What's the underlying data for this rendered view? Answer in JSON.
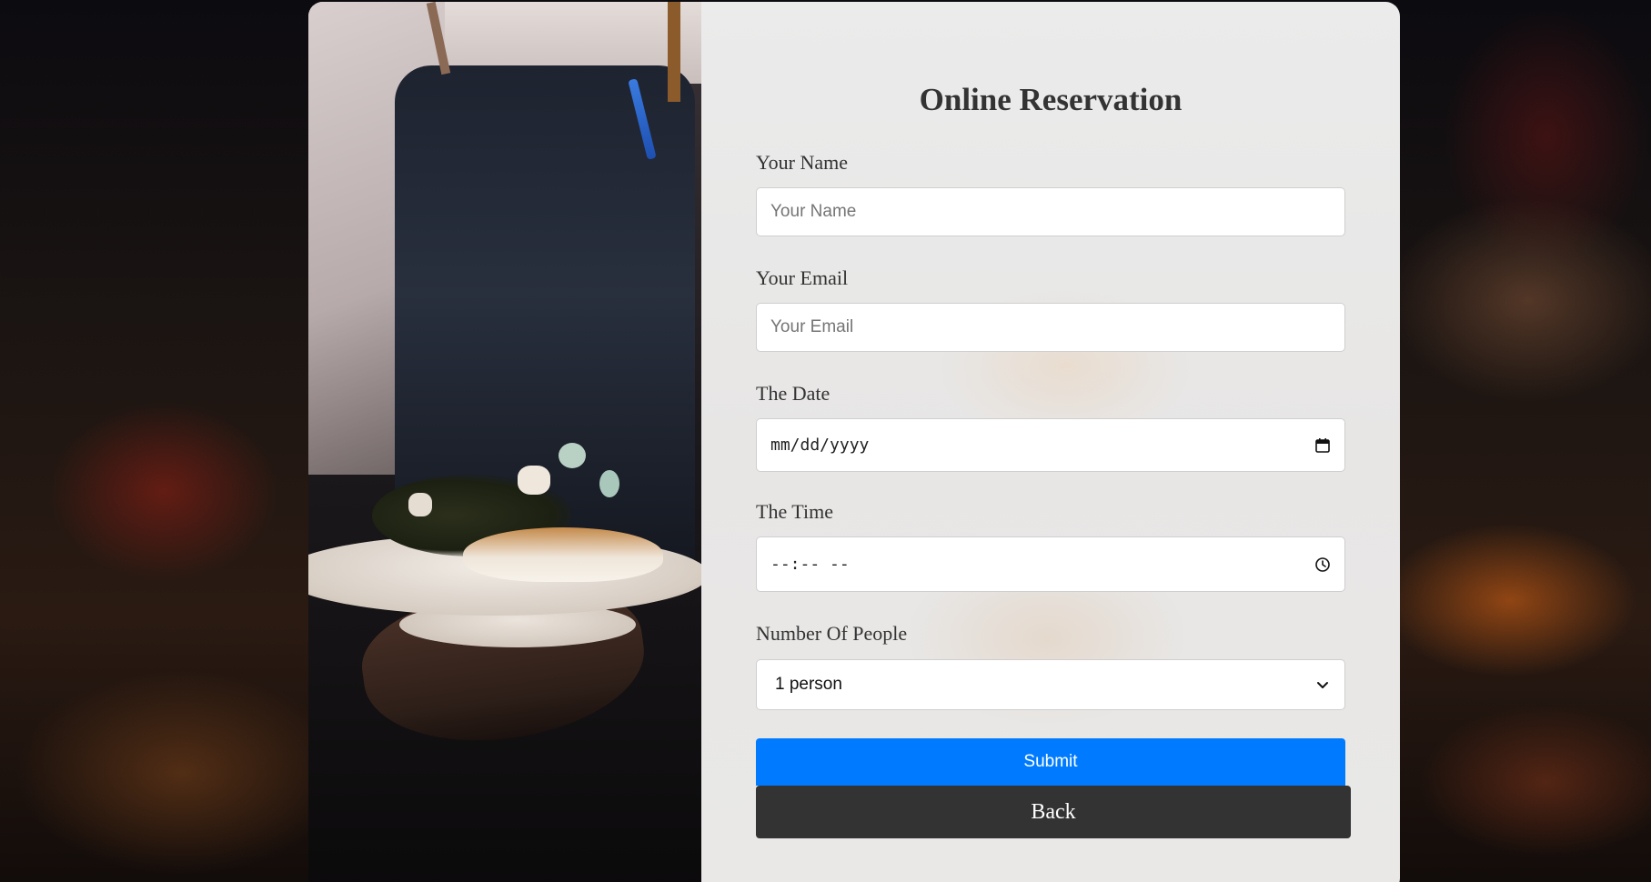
{
  "form": {
    "title": "Online Reservation",
    "name_label": "Your Name",
    "name_placeholder": "Your Name",
    "email_label": "Your Email",
    "email_placeholder": "Your Email",
    "date_label": "The Date",
    "date_placeholder": "mm/dd/yyyy",
    "date_icon": "calendar-icon",
    "time_label": "The Time",
    "time_placeholder": "--:-- --",
    "time_icon": "clock-icon",
    "people_label": "Number Of People",
    "people_selected": "1 person",
    "people_icon": "chevron-down-icon",
    "submit_label": "Submit",
    "back_label": "Back"
  },
  "colors": {
    "submit_bg": "#007bff",
    "back_bg": "#333333",
    "text": "#333333"
  }
}
